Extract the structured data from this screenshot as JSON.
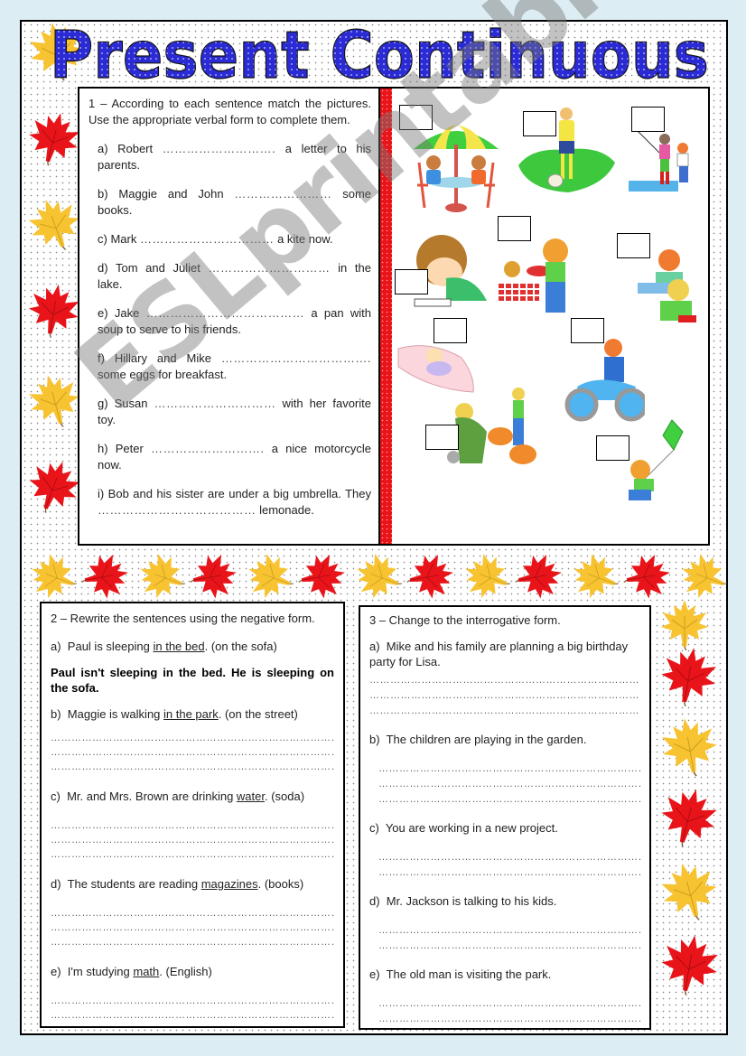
{
  "title": "Present Continuous",
  "exercise1": {
    "instruction": "1 – According to each sentence match the pictures. Use the appropriate verbal form to complete them.",
    "items": [
      {
        "letter": "a)",
        "before": "Robert",
        "blank": "……………………….",
        "after": "a letter to his parents."
      },
      {
        "letter": "b)",
        "before": "Maggie and John",
        "blank": "……………………",
        "after": "some books."
      },
      {
        "letter": "c)",
        "before": "Mark",
        "blank": "……………………………",
        "after": "a kite now."
      },
      {
        "letter": "d)",
        "before": "Tom and Juliet",
        "blank": "…………………………",
        "after": "in the lake."
      },
      {
        "letter": "e)",
        "before": "Jake",
        "blank": "…………………………………",
        "after": "a pan with soup to serve to his friends."
      },
      {
        "letter": "f)",
        "before": "Hillary and Mike",
        "blank": "……………………………….",
        "after": "some eggs for breakfast."
      },
      {
        "letter": "g)",
        "before": "Susan",
        "blank": "…………………………",
        "after": "with her favorite toy."
      },
      {
        "letter": "h)",
        "before": "Peter",
        "blank": "……………………….",
        "after": "a nice motorcycle now."
      },
      {
        "letter": "i)",
        "before": "Bob and his sister are under a big umbrella. They",
        "blank": "…………………………………",
        "after": "lemonade."
      }
    ],
    "pictures": [
      {
        "name": "umbrella-table-picture",
        "label": ""
      },
      {
        "name": "football-player-picture",
        "label": ""
      },
      {
        "name": "fishing-picture",
        "label": ""
      },
      {
        "name": "writing-boy-picture",
        "label": ""
      },
      {
        "name": "soup-boy-picture",
        "label": ""
      },
      {
        "name": "reading-kids-picture",
        "label": ""
      },
      {
        "name": "sleeping-baby-picture",
        "label": ""
      },
      {
        "name": "motorcycle-picture",
        "label": ""
      },
      {
        "name": "chickens-eggs-picture",
        "label": ""
      },
      {
        "name": "kite-boy-picture",
        "label": ""
      }
    ]
  },
  "exercise2": {
    "instruction": "2 – Rewrite the sentences using the negative form.",
    "example": {
      "letter": "a)",
      "before": "Paul is sleeping",
      "underlined": "in the bed",
      "after": ". (on the sofa)",
      "answer": "Paul isn't sleeping in the bed. He is sleeping on the sofa."
    },
    "items": [
      {
        "letter": "b)",
        "before": "Maggie is walking",
        "underlined": "in the park",
        "after": ". (on the street)",
        "lines": 3
      },
      {
        "letter": "c)",
        "before": "Mr. and Mrs. Brown are drinking",
        "underlined": "water",
        "after": ". (soda)",
        "lines": 3
      },
      {
        "letter": "d)",
        "before": "The students are reading",
        "underlined": "magazines",
        "after": ". (books)",
        "lines": 3
      },
      {
        "letter": "e)",
        "before": "I'm studying",
        "underlined": "math",
        "after": ". (English)",
        "lines": 2
      }
    ],
    "dotline": "……………………………………………………………………………"
  },
  "exercise3": {
    "instruction": "3 – Change to the interrogative form.",
    "items": [
      {
        "letter": "a)",
        "text": "Mike and his family are planning a big birthday party for Lisa.",
        "lines": 3
      },
      {
        "letter": "b)",
        "text": "The children are playing in the garden.",
        "lines": 3
      },
      {
        "letter": "c)",
        "text": "You are working in a new project.",
        "lines": 2
      },
      {
        "letter": "d)",
        "text": "Mr. Jackson is talking to his kids.",
        "lines": 2
      },
      {
        "letter": "e)",
        "text": "The old man is visiting the park.",
        "lines": 2
      }
    ],
    "dotline": "……………………………………………………………………"
  },
  "watermark": "ESLprintables.com",
  "colors": {
    "title_fill": "#2b2bd6",
    "red_leaf": "#e8141a",
    "yellow_leaf": "#f7c331",
    "page_bg": "#dcedf3",
    "red_bar": "#e8141a"
  }
}
